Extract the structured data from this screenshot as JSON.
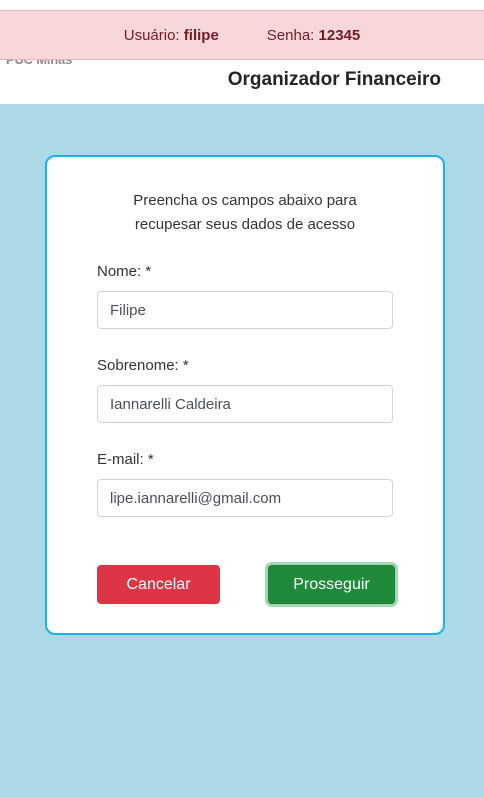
{
  "alert": {
    "user_label": "Usuário:",
    "user_value": "filipe",
    "password_label": "Senha:",
    "password_value": "12345",
    "color": "#721c24",
    "background": "#f8d7da"
  },
  "header": {
    "logo_text": "PUC Minas",
    "app_title": "Organizador Financeiro"
  },
  "form": {
    "intro_line1": "Preencha os campos abaixo para",
    "intro_line2": "recupesar seus dados de acesso",
    "first_name": {
      "label": "Nome: *",
      "value": "Filipe"
    },
    "last_name": {
      "label": "Sobrenome: *",
      "value": "Iannarelli Caldeira"
    },
    "email": {
      "label": "E-mail: *",
      "value": "lipe.iannarelli@gmail.com"
    },
    "cancel_label": "Cancelar",
    "proceed_label": "Prosseguir"
  },
  "colors": {
    "page_background": "#add8e6",
    "card_border": "#17b3e6",
    "cancel": "#dc3545",
    "proceed": "#1e8a3a"
  }
}
